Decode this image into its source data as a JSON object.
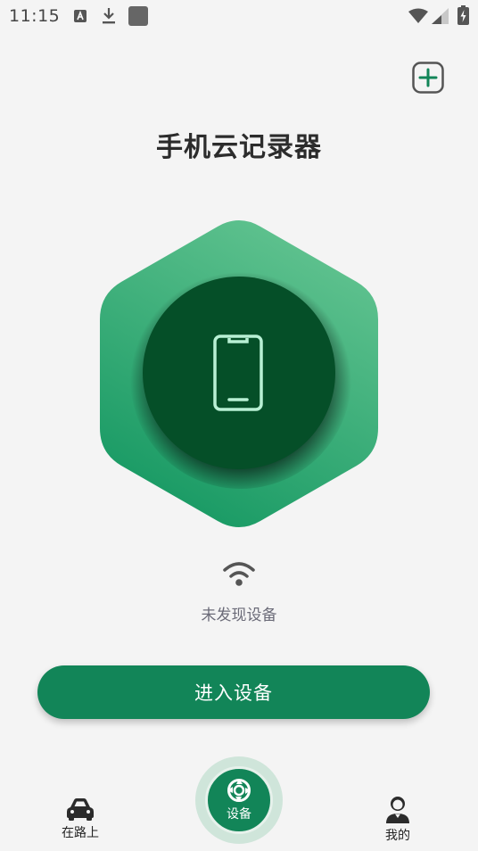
{
  "status_bar": {
    "time": "11:15"
  },
  "header": {
    "title": "手机云记录器"
  },
  "device": {
    "status_text": "未发现设备"
  },
  "actions": {
    "enter_label": "进入设备"
  },
  "bottom_nav": {
    "items": [
      {
        "label": "在路上",
        "icon": "car-icon"
      },
      {
        "label": "设备",
        "icon": "device-hub-icon"
      },
      {
        "label": "我的",
        "icon": "user-icon"
      }
    ]
  },
  "colors": {
    "accent": "#128558",
    "hex_light": "#5cc08f",
    "hex_dark": "#1f9466",
    "circle": "#064f28",
    "phone_line": "#b8f0d4"
  }
}
